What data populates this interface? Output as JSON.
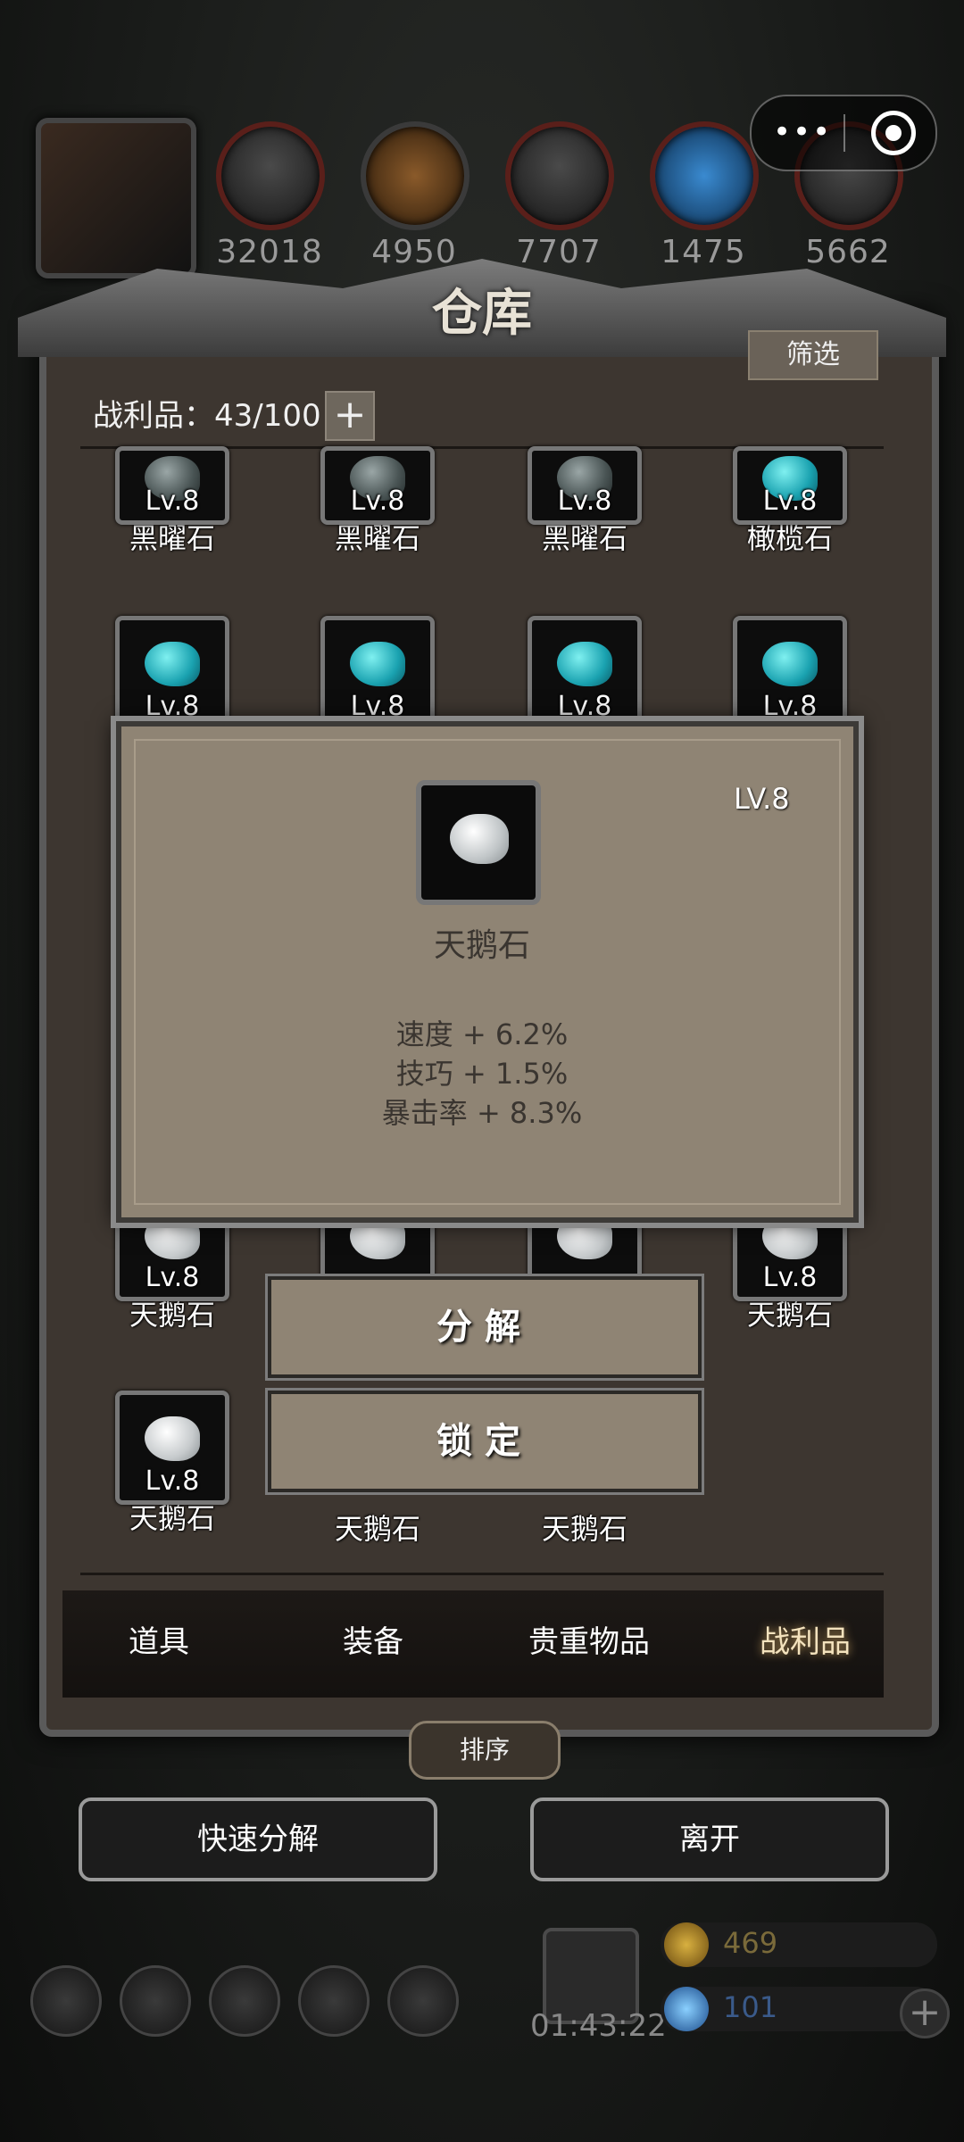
{
  "resources": [
    {
      "icon": "leather-icon",
      "value": "32018"
    },
    {
      "icon": "wood-icon",
      "value": "4950"
    },
    {
      "icon": "iron-ingot-icon",
      "value": "7707"
    },
    {
      "icon": "crystal-icon",
      "value": "1475"
    },
    {
      "icon": "anvil-icon",
      "value": "5662"
    }
  ],
  "capsule": {
    "menu": "•••"
  },
  "warehouse": {
    "title": "仓库",
    "filter_label": "筛选",
    "loot_label": "战利品：43/100",
    "plus_label": "+"
  },
  "items": [
    {
      "level": "Lv.8",
      "name": "黑曜石",
      "gem": "obsidian"
    },
    {
      "level": "Lv.8",
      "name": "黑曜石",
      "gem": "obsidian"
    },
    {
      "level": "Lv.8",
      "name": "黑曜石",
      "gem": "obsidian"
    },
    {
      "level": "Lv.8",
      "name": "橄榄石",
      "gem": "teal"
    },
    {
      "level": "Lv.8",
      "name": "",
      "gem": "teal"
    },
    {
      "level": "Lv.8",
      "name": "",
      "gem": "teal"
    },
    {
      "level": "Lv.8",
      "name": "",
      "gem": "teal"
    },
    {
      "level": "Lv.8",
      "name": "",
      "gem": "teal"
    },
    {
      "level": "Lv.8",
      "name": "天鹅石",
      "gem": "swan"
    },
    {
      "level": "",
      "name": "",
      "gem": "swan"
    },
    {
      "level": "",
      "name": "",
      "gem": "swan"
    },
    {
      "level": "Lv.8",
      "name": "天鹅石",
      "gem": "swan"
    },
    {
      "level": "Lv.8",
      "name": "天鹅石",
      "gem": "swan"
    },
    {
      "level": "",
      "name": "天鹅石",
      "gem": "none"
    },
    {
      "level": "",
      "name": "天鹅石",
      "gem": "none"
    }
  ],
  "popup": {
    "level": "LV.8",
    "name": "天鹅石",
    "stats": [
      "速度 + 6.2%",
      "技巧 + 1.5%",
      "暴击率 + 8.3%"
    ]
  },
  "actions": {
    "decompose": "分解",
    "lock": "锁定"
  },
  "tabs": [
    {
      "label": "道具",
      "active": false
    },
    {
      "label": "装备",
      "active": false
    },
    {
      "label": "贵重物品",
      "active": false
    },
    {
      "label": "战利品",
      "active": true
    }
  ],
  "sort_label": "排序",
  "bottom_buttons": {
    "quick_decompose": "快速分解",
    "leave": "离开"
  },
  "footer": {
    "timer": "01:43:22",
    "gold": "469",
    "gems": "101",
    "gold_color": "#7a6a3a",
    "gem_color": "#3a5a8a"
  }
}
